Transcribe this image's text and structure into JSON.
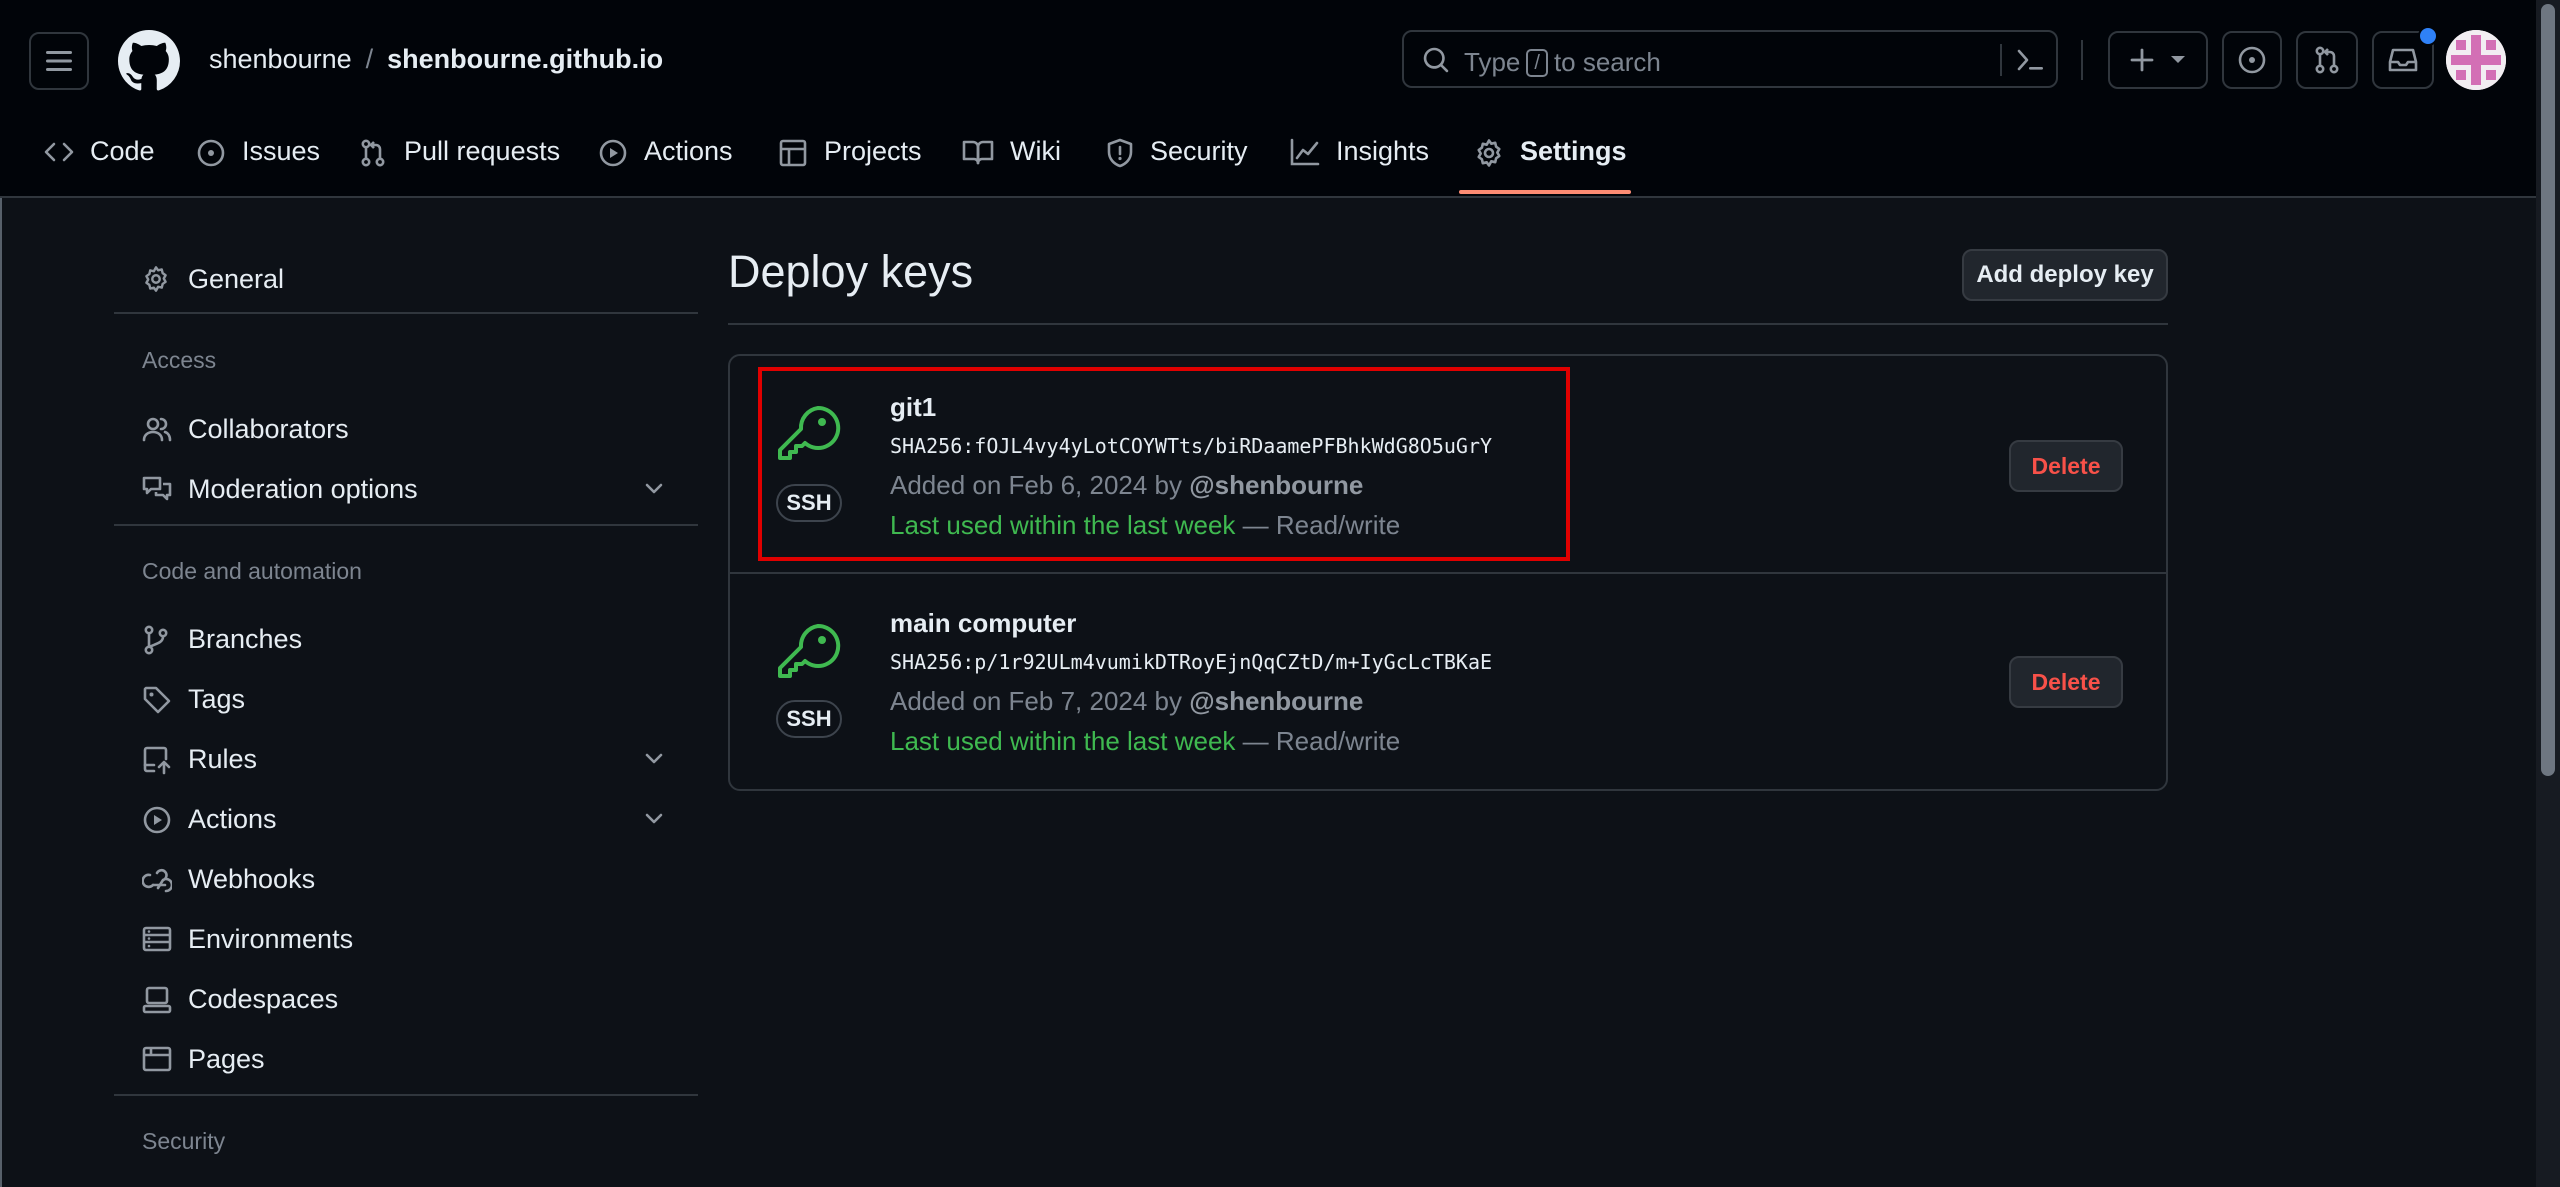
{
  "header": {
    "owner": "shenbourne",
    "separator": "/",
    "repo": "shenbourne.github.io",
    "search_prefix": "Type",
    "search_key": "/",
    "search_suffix": "to search"
  },
  "repo_nav": {
    "items": [
      {
        "label": "Code",
        "icon": "code-icon"
      },
      {
        "label": "Issues",
        "icon": "issue-opened-icon"
      },
      {
        "label": "Pull requests",
        "icon": "git-pull-request-icon"
      },
      {
        "label": "Actions",
        "icon": "play-icon"
      },
      {
        "label": "Projects",
        "icon": "table-icon"
      },
      {
        "label": "Wiki",
        "icon": "book-icon"
      },
      {
        "label": "Security",
        "icon": "shield-icon"
      },
      {
        "label": "Insights",
        "icon": "graph-icon"
      },
      {
        "label": "Settings",
        "icon": "gear-icon"
      }
    ],
    "selected": "Settings"
  },
  "sidebar": {
    "general": "General",
    "access_heading": "Access",
    "collaborators": "Collaborators",
    "moderation": "Moderation options",
    "code_heading": "Code and automation",
    "branches": "Branches",
    "tags": "Tags",
    "rules": "Rules",
    "actions": "Actions",
    "webhooks": "Webhooks",
    "environments": "Environments",
    "codespaces": "Codespaces",
    "pages": "Pages",
    "security_heading": "Security"
  },
  "main": {
    "title": "Deploy keys",
    "add_button": "Add deploy key",
    "keys": [
      {
        "title": "git1",
        "badge": "SSH",
        "fingerprint": "SHA256:fOJL4vy4yLotCOYWTts/biRDaamePFBhkWdG8O5uGrY",
        "added_prefix": "Added on Feb 6, 2024 by",
        "added_by": "@shenbourne",
        "last_used": "Last used within the last week",
        "access": "— Read/write",
        "delete_label": "Delete"
      },
      {
        "title": "main computer",
        "badge": "SSH",
        "fingerprint": "SHA256:p/1r92ULm4vumikDTRoyEjnQqCZtD/m+IyGcLcTBKaE",
        "added_prefix": "Added on Feb 7, 2024 by",
        "added_by": "@shenbourne",
        "last_used": "Last used within the last week",
        "access": "— Read/write",
        "delete_label": "Delete"
      }
    ]
  },
  "colors": {
    "background": "#0d1117",
    "header_bg": "#010409",
    "accent_underline": "#fd8c73",
    "key_green": "#3fb950",
    "danger": "#f85149",
    "highlight": "#e00000"
  }
}
